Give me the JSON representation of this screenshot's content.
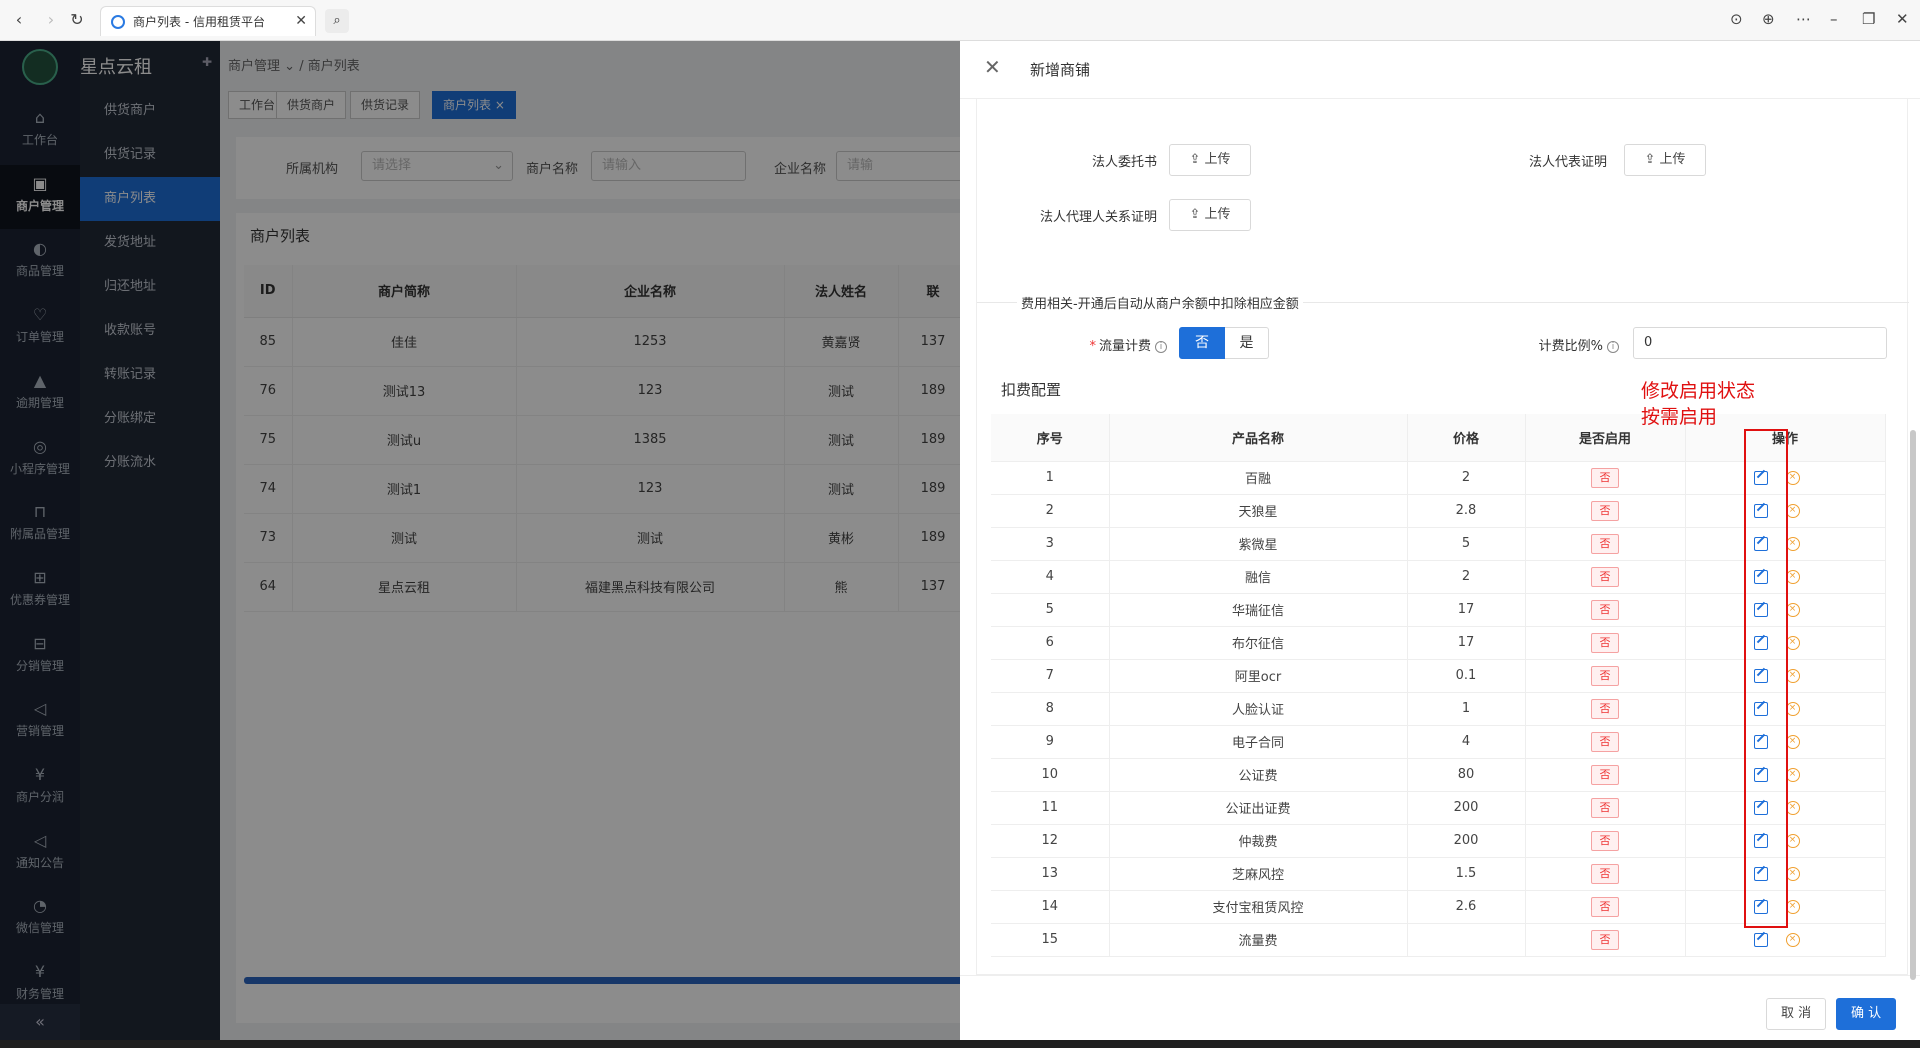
{
  "browser": {
    "tab_title": "商户列表 - 信用租赁平台",
    "nav": {
      "back": "‹",
      "forward": "›",
      "reload": "↻",
      "search": "⌕"
    },
    "right_icons": [
      "download-icon",
      "globe-icon",
      "more-icon",
      "minimize-icon",
      "restore-icon",
      "close-icon"
    ]
  },
  "app": {
    "brand": "星点云租",
    "icon_nav": [
      {
        "label": "工作台",
        "icon": "⌂"
      },
      {
        "label": "商户管理",
        "icon": "▣"
      },
      {
        "label": "商品管理",
        "icon": "◐"
      },
      {
        "label": "订单管理",
        "icon": "♡"
      },
      {
        "label": "逾期管理",
        "icon": "▲"
      },
      {
        "label": "小程序管理",
        "icon": "◎"
      },
      {
        "label": "附属品管理",
        "icon": "⊓"
      },
      {
        "label": "优惠券管理",
        "icon": "⊞"
      },
      {
        "label": "分销管理",
        "icon": "⊟"
      },
      {
        "label": "营销管理",
        "icon": "◁"
      },
      {
        "label": "商户分润",
        "icon": "¥"
      },
      {
        "label": "通知公告",
        "icon": "◁"
      },
      {
        "label": "微信管理",
        "icon": "◔"
      },
      {
        "label": "财务管理",
        "icon": "¥"
      }
    ],
    "collapse": "«",
    "sub_nav": [
      "供货商户",
      "供货记录",
      "商户列表",
      "发货地址",
      "归还地址",
      "收款账号",
      "转账记录",
      "分账绑定",
      "分账流水"
    ],
    "breadcrumb": {
      "parent": "商户管理",
      "current": "商户列表"
    },
    "tags": [
      "工作台",
      "供货商户",
      "供货记录",
      "商户列表"
    ],
    "tag_close": "×",
    "filters": {
      "org_label": "所属机构",
      "org_placeholder": "请选择",
      "merchant_label": "商户名称",
      "merchant_placeholder": "请输入",
      "company_label": "企业名称",
      "company_placeholder": "请输"
    },
    "list": {
      "title": "商户列表",
      "columns": [
        "ID",
        "商户简称",
        "企业名称",
        "法人姓名",
        "联"
      ],
      "rows": [
        [
          "85",
          "佳佳",
          "1253",
          "黄嘉贤",
          "137"
        ],
        [
          "76",
          "测试13",
          "123",
          "测试",
          "189"
        ],
        [
          "75",
          "测试u",
          "1385",
          "测试",
          "189"
        ],
        [
          "74",
          "测试1",
          "123",
          "测试",
          "189"
        ],
        [
          "73",
          "测试",
          "测试",
          "黄彬",
          "189"
        ],
        [
          "64",
          "星点云租",
          "福建黑点科技有限公司",
          "熊",
          "137"
        ]
      ]
    }
  },
  "drawer": {
    "title": "新增商铺",
    "close": "✕",
    "uploads": {
      "entrust_label": "法人委托书",
      "rep_cert_label": "法人代表证明",
      "relation_label": "法人代理人关系证明",
      "button": "上传"
    },
    "fee_section": "费用相关-开通后自动从商户余额中扣除相应金额",
    "traffic_label": "流量计费",
    "traffic_options": [
      "否",
      "是"
    ],
    "ratio_label": "计费比例%",
    "ratio_value": "0",
    "deduct_title": "扣费配置",
    "table": {
      "columns": [
        "序号",
        "产品名称",
        "价格",
        "是否启用",
        "操作"
      ],
      "rows": [
        {
          "no": "1",
          "name": "百融",
          "price": "2",
          "enabled": "否"
        },
        {
          "no": "2",
          "name": "天狼星",
          "price": "2.8",
          "enabled": "否"
        },
        {
          "no": "3",
          "name": "紫微星",
          "price": "5",
          "enabled": "否"
        },
        {
          "no": "4",
          "name": "融信",
          "price": "2",
          "enabled": "否"
        },
        {
          "no": "5",
          "name": "华瑞征信",
          "price": "17",
          "enabled": "否"
        },
        {
          "no": "6",
          "name": "布尔征信",
          "price": "17",
          "enabled": "否"
        },
        {
          "no": "7",
          "name": "阿里ocr",
          "price": "0.1",
          "enabled": "否"
        },
        {
          "no": "8",
          "name": "人脸认证",
          "price": "1",
          "enabled": "否"
        },
        {
          "no": "9",
          "name": "电子合同",
          "price": "4",
          "enabled": "否"
        },
        {
          "no": "10",
          "name": "公证费",
          "price": "80",
          "enabled": "否"
        },
        {
          "no": "11",
          "name": "公证出证费",
          "price": "200",
          "enabled": "否"
        },
        {
          "no": "12",
          "name": "仲裁费",
          "price": "200",
          "enabled": "否"
        },
        {
          "no": "13",
          "name": "芝麻风控",
          "price": "1.5",
          "enabled": "否"
        },
        {
          "no": "14",
          "name": "支付宝租赁风控",
          "price": "2.6",
          "enabled": "否"
        },
        {
          "no": "15",
          "name": "流量费",
          "price": "",
          "enabled": "否"
        }
      ]
    },
    "annotation_line1": "修改启用状态",
    "annotation_line2": "按需启用",
    "cancel": "取 消",
    "confirm": "确 认"
  },
  "colors": {
    "primary": "#1e6fd9",
    "annotation": "#e01010",
    "sidebar": "#1c2433"
  }
}
